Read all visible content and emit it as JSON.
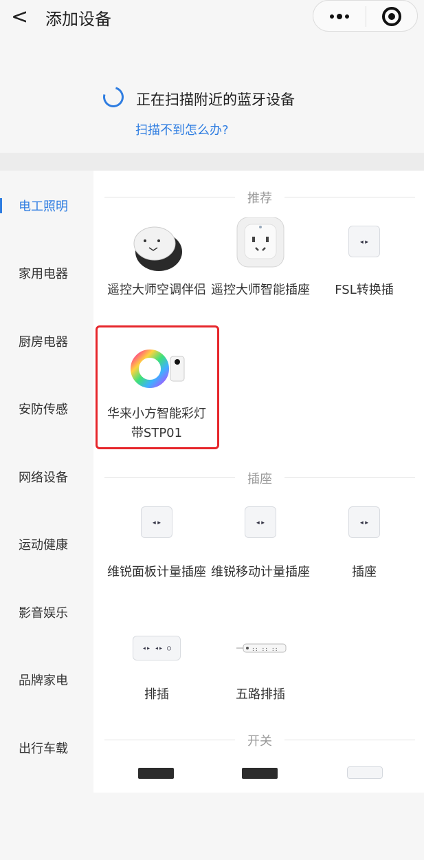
{
  "header": {
    "back_label": "<",
    "title": "添加设备"
  },
  "capsule": {
    "more_icon": "more-icon",
    "close_icon": "target-icon"
  },
  "scan": {
    "status": "正在扫描附近的蓝牙设备",
    "help_link": "扫描不到怎么办?"
  },
  "sidebar": {
    "items": [
      {
        "label": "电工照明",
        "active": true
      },
      {
        "label": "家用电器"
      },
      {
        "label": "厨房电器"
      },
      {
        "label": "安防传感"
      },
      {
        "label": "网络设备"
      },
      {
        "label": "运动健康"
      },
      {
        "label": "影音娱乐"
      },
      {
        "label": "品牌家电"
      },
      {
        "label": "出行车载"
      }
    ]
  },
  "sections": {
    "recommend": {
      "title": "推荐",
      "items": [
        {
          "name": "遥控大师空调伴侣"
        },
        {
          "name": "遥控大师智能插座"
        },
        {
          "name": "FSL转换插"
        },
        {
          "name": "华来小方智能彩灯带STP01"
        }
      ]
    },
    "socket": {
      "title": "插座",
      "items": [
        {
          "name": "维锐面板计量插座"
        },
        {
          "name": "维锐移动计量插座"
        },
        {
          "name": "插座"
        },
        {
          "name": "排插"
        },
        {
          "name": "五路排插"
        }
      ]
    },
    "switch": {
      "title": "开关"
    }
  },
  "colors": {
    "accent": "#2f7de1",
    "highlight": "#e6262b"
  }
}
